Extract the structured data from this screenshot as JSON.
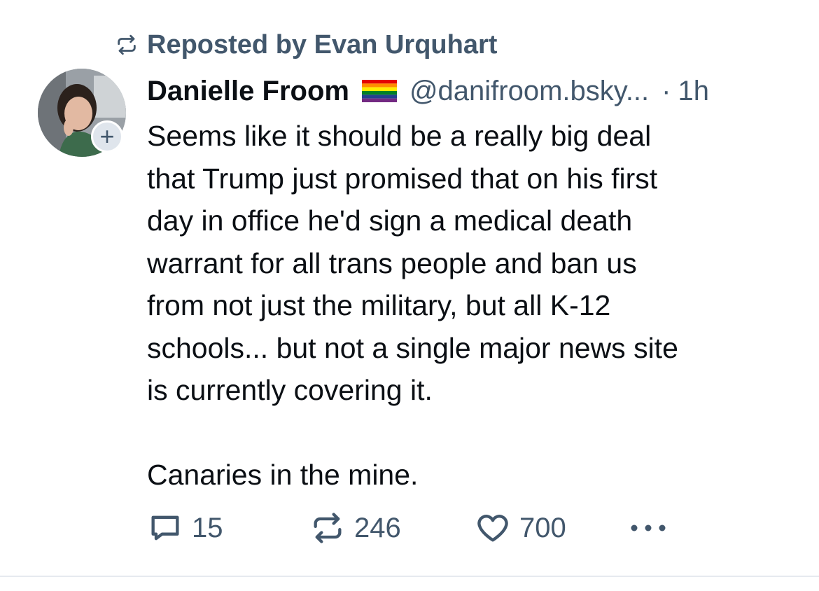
{
  "repost": {
    "text": "Reposted by Evan Urquhart",
    "icon": "repost-icon"
  },
  "author": {
    "display_name": "Danielle Froom",
    "flag_icon": "rainbow-flag-icon",
    "handle": "@danifroom.bsky...",
    "separator": "·",
    "time": "1h"
  },
  "avatar": {
    "follow_symbol": "+"
  },
  "post": {
    "text": "Seems like it should be a really big deal\nthat Trump just promised that on his first\nday in office he'd sign a medical death\nwarrant for all trans people and ban us\nfrom not just the military, but all K-12\nschools... but not a single major news site\nis currently covering it.\n\nCanaries in the mine."
  },
  "actions": {
    "replies": "15",
    "reposts": "246",
    "likes": "700"
  },
  "colors": {
    "muted": "#42576c",
    "text": "#0b0f14",
    "divider": "#e6eaef"
  }
}
